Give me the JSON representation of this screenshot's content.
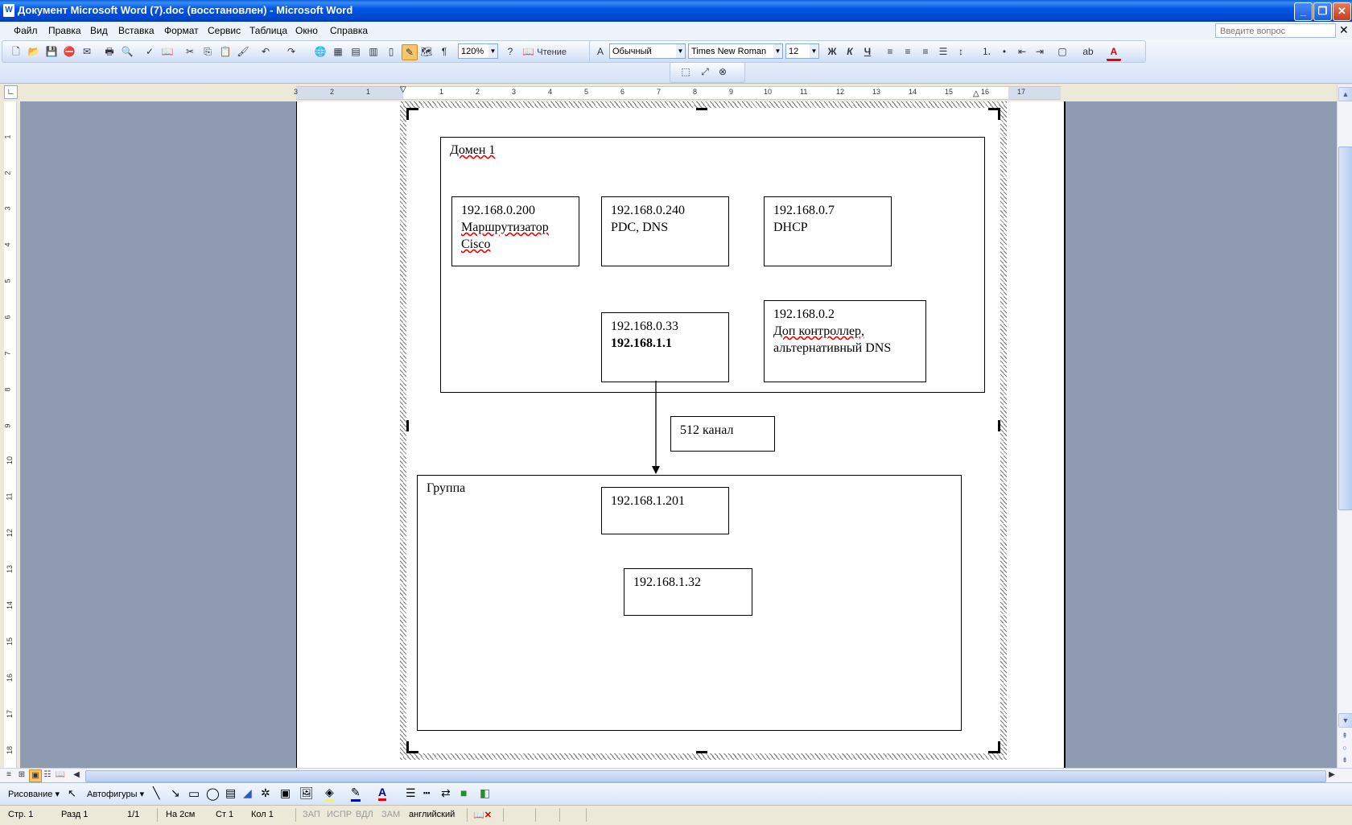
{
  "window": {
    "title": "Документ Microsoft Word (7).doc (восстановлен) - Microsoft Word"
  },
  "menu": {
    "items": [
      "Файл",
      "Правка",
      "Вид",
      "Вставка",
      "Формат",
      "Сервис",
      "Таблица",
      "Окно",
      "Справка"
    ],
    "ask_placeholder": "Введите вопрос"
  },
  "toolbar": {
    "zoom": "120%",
    "reading": "Чтение",
    "style": "Обычный",
    "font": "Times New Roman",
    "size": "12",
    "bold": "Ж",
    "italic": "К",
    "underline": "Ч"
  },
  "ruler": {
    "h_numbers": [
      "3",
      "2",
      "1",
      "1",
      "2",
      "3",
      "4",
      "5",
      "6",
      "7",
      "8",
      "9",
      "10",
      "11",
      "12",
      "13",
      "14",
      "15",
      "16",
      "17"
    ],
    "v_numbers": [
      "1",
      "2",
      "3",
      "4",
      "5",
      "6",
      "7",
      "8",
      "9",
      "10",
      "11",
      "12",
      "13",
      "14",
      "15",
      "16",
      "17",
      "18"
    ]
  },
  "diagram": {
    "domain": {
      "label": "Домен 1",
      "nodes": [
        {
          "ip": "192.168.0.200",
          "line2": "Маршрутизатор",
          "line3": "Cisco"
        },
        {
          "ip": "192.168.0.240",
          "line2": "PDC, DNS"
        },
        {
          "ip": "192.168.0.7",
          "line2": "DHCP"
        },
        {
          "ip": "192.168.0.33",
          "line2": "192.168.1.1"
        },
        {
          "ip": "192.168.0.2",
          "line2": "Доп контроллер,",
          "line3": "альтернативный DNS"
        }
      ]
    },
    "link_label": "512 канал",
    "group": {
      "label": "Группа",
      "nodes": [
        {
          "ip": "192.168.1.201"
        },
        {
          "ip": "192.168.1.32"
        }
      ]
    }
  },
  "drawing_toolbar": {
    "draw": "Рисование",
    "autoshapes": "Автофигуры"
  },
  "status": {
    "page": "Стр. 1",
    "section": "Разд 1",
    "pages": "1/1",
    "at": "На 2см",
    "line": "Ст 1",
    "col": "Кол 1",
    "rec": "ЗАП",
    "trk": "ИСПР",
    "ext": "ВДЛ",
    "ovr": "ЗАМ",
    "lang": "английский"
  },
  "colors": {
    "titlebar": "#0054e3",
    "page_bg": "#8f9bb0",
    "spell_underline": "#e00000"
  }
}
